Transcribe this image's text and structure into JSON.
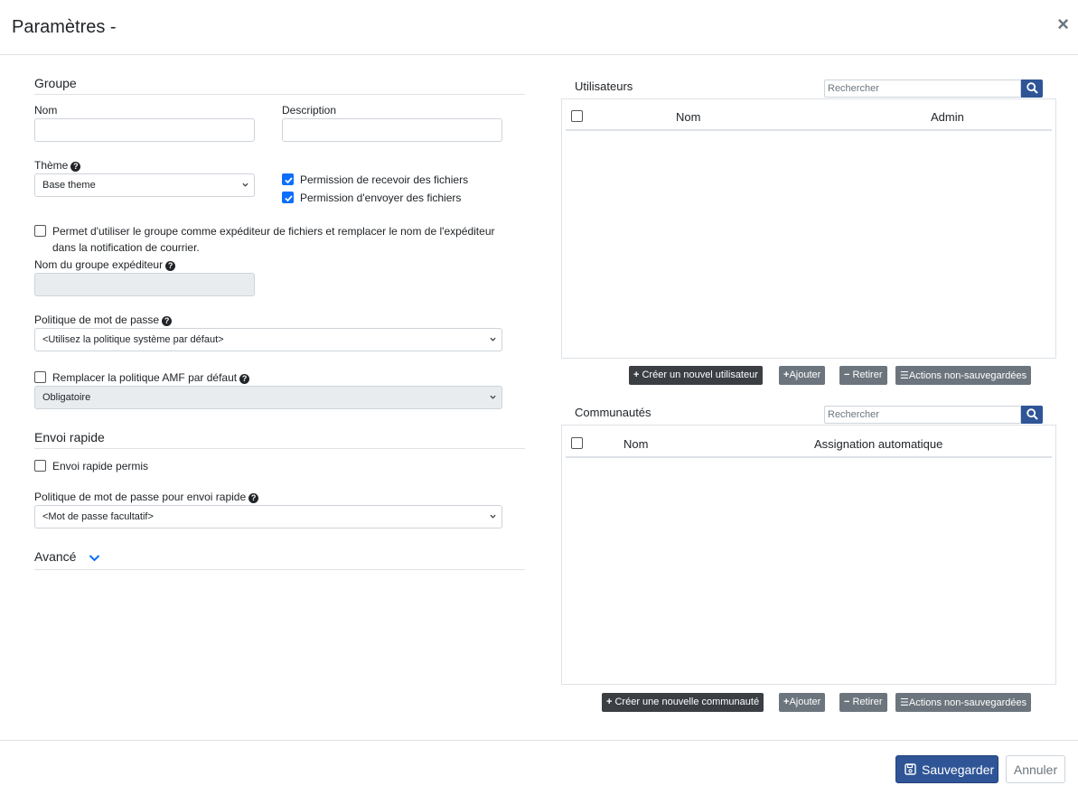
{
  "dialog": {
    "title": "Paramètres -",
    "close_label": "×"
  },
  "group": {
    "section_title": "Groupe",
    "name_label": "Nom",
    "name_value": "",
    "description_label": "Description",
    "description_value": "",
    "theme_label": "Thème",
    "theme_value": "Base theme",
    "perm_receive_label": "Permission de recevoir des fichiers",
    "perm_receive_checked": true,
    "perm_send_label": "Permission d'envoyer des fichiers",
    "perm_send_checked": true,
    "sender_group_label_line1": "Permet d'utiliser le groupe comme expéditeur de fichiers et remplacer le nom de l'expéditeur",
    "sender_group_label_line2": "dans la notification de courrier.",
    "sender_group_checked": false,
    "sender_name_label": "Nom du groupe expéditeur",
    "password_policy_label": "Politique de mot de passe",
    "password_policy_value": "<Utilisez la politique système par défaut>",
    "mfa_override_label": "Remplacer la politique AMF par défaut",
    "mfa_override_checked": false,
    "mfa_value": "Obligatoire"
  },
  "quick_send": {
    "section_title": "Envoi rapide",
    "allowed_label": "Envoi rapide permis",
    "allowed_checked": false,
    "password_policy_label": "Politique de mot de passe pour envoi rapide",
    "password_policy_value": "<Mot de passe facultatif>"
  },
  "advanced": {
    "label": "Avancé"
  },
  "users": {
    "title": "Utilisateurs",
    "search_placeholder": "Rechercher",
    "col_name": "Nom",
    "col_admin": "Admin",
    "btn_create": "Créer un nouvel utilisateur",
    "btn_add": "Ajouter",
    "btn_remove": "Retirer",
    "btn_unsaved": "Actions non-sauvegardées"
  },
  "communities": {
    "title": "Communautés",
    "search_placeholder": "Rechercher",
    "col_name": "Nom",
    "col_auto": "Assignation automatique",
    "btn_create": "Créer une nouvelle communauté",
    "btn_add": "Ajouter",
    "btn_remove": "Retirer",
    "btn_unsaved": "Actions non-sauvegardées"
  },
  "footer": {
    "save_label": "Sauvegarder",
    "cancel_label": "Annuler"
  },
  "colors": {
    "primary": "#2f5597",
    "checkbox_checked": "#0d6efd",
    "dark_button": "#3b3f44",
    "grey_button": "#6c757d"
  }
}
